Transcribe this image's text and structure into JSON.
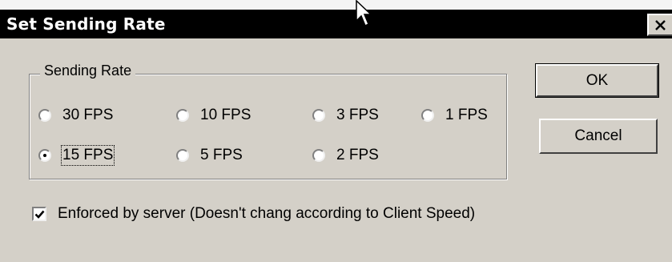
{
  "dialog": {
    "title": "Set Sending Rate",
    "close_icon": "close-icon"
  },
  "group": {
    "label": "Sending Rate",
    "options": [
      {
        "label": "30 FPS",
        "checked": false
      },
      {
        "label": "10 FPS",
        "checked": false
      },
      {
        "label": "3 FPS",
        "checked": false
      },
      {
        "label": "1 FPS",
        "checked": false
      },
      {
        "label": "15 FPS",
        "checked": true
      },
      {
        "label": "5 FPS",
        "checked": false
      },
      {
        "label": "2 FPS",
        "checked": false
      }
    ]
  },
  "buttons": {
    "ok": "OK",
    "cancel": "Cancel"
  },
  "enforce": {
    "label": "Enforced by server (Doesn't chang according to Client Speed)",
    "checked": true
  },
  "colors": {
    "titlebar": "#000000",
    "face": "#d4d0c8"
  }
}
